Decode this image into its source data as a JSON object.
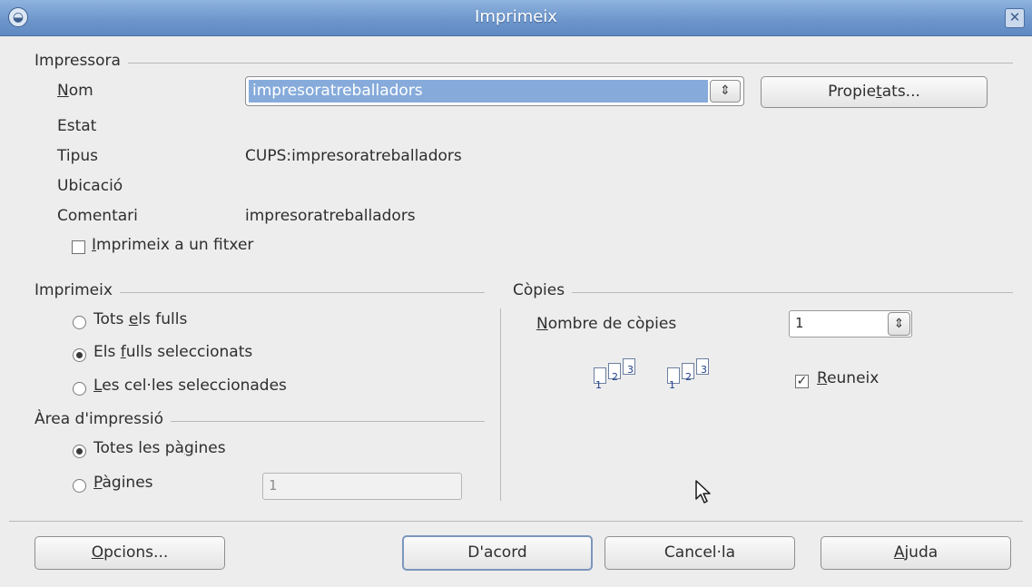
{
  "window": {
    "title": "Imprimeix",
    "menu_icon": "window-menu-icon",
    "close_icon": "close-icon",
    "close_glyph": "✕",
    "menu_glyph": "◒"
  },
  "printer": {
    "group_label": "Impressora",
    "name_label_mnemonic": "N",
    "name_label_rest": "om",
    "name_value": "impresoratreballadors",
    "properties_before": "Propie",
    "properties_mnemonic": "t",
    "properties_after": "ats...",
    "status_label": "Estat",
    "status_value": "",
    "type_label": "Tipus",
    "type_value": "CUPS:impresoratreballadors",
    "location_label": "Ubicació",
    "location_value": "",
    "comment_label": "Comentari",
    "comment_value": "impresoratreballadors",
    "print_to_file_mnemonic": "I",
    "print_to_file_rest": "mprimeix a un fitxer",
    "print_to_file_checked": false
  },
  "print_range": {
    "group_label": "Imprimeix",
    "options": [
      {
        "before": "Tots ",
        "mnemonic": "e",
        "after": "ls fulls",
        "selected": false
      },
      {
        "before": "Els ",
        "mnemonic": "f",
        "after": "ulls seleccionats",
        "selected": true
      },
      {
        "before": "",
        "mnemonic": "L",
        "after": "es cel·les seleccionades",
        "selected": false
      }
    ]
  },
  "print_area": {
    "group_label": "Àrea d'impressió",
    "all_pages_before": "Totes les pà",
    "all_pages_mnemonic": "g",
    "all_pages_after": "ines",
    "all_pages_selected": true,
    "pages_mnemonic": "P",
    "pages_rest": "àgines",
    "pages_selected": false,
    "pages_value": "1"
  },
  "copies": {
    "group_label": "Còpies",
    "count_label_mnemonic": "N",
    "count_label_rest": "ombre de còpies",
    "count_value": "1",
    "collate_mnemonic": "R",
    "collate_rest": "euneix",
    "collate_checked": true,
    "collate_glyph": "✓"
  },
  "buttons": {
    "options_mnemonic": "O",
    "options_rest": "pcions...",
    "ok": "D'acord",
    "cancel": "Cancel·la",
    "help_mnemonic": "A",
    "help_rest": "juda"
  },
  "icons": {
    "spin": "⇕",
    "spin_icon": "spin-arrows-icon",
    "cursor": "mouse-pointer-icon",
    "page_numbers": [
      "1",
      "2",
      "3"
    ]
  },
  "colors": {
    "titlebar": "#6e97cc",
    "selection": "#86abdb",
    "background": "#ededed"
  }
}
